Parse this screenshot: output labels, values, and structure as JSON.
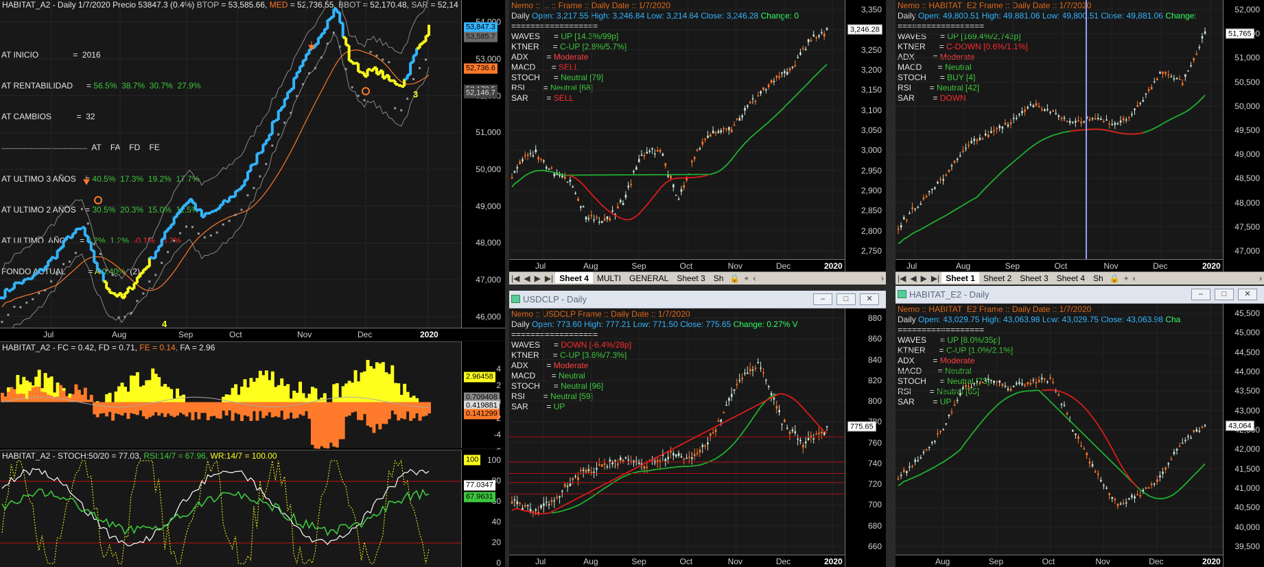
{
  "colors": {
    "bg": "#181818",
    "cyan": "#33b5ff",
    "yellow": "#ffff1e",
    "orange": "#ff7a2a",
    "green": "#3ec83e",
    "red": "#ff2a2a",
    "white": "#ffffff",
    "grey": "#999999",
    "pale": "#cde6d8"
  },
  "left": {
    "header": {
      "prefix": "HABITAT_A2 - Daily 1/7/2020 Precio 53847.3 (0.4%)",
      "btop_label": "BTOP",
      "btop_val": " = 53,585.66,",
      "med_label": "MED",
      "med_val": " = 52,736.55,",
      "bbot_label": "BBOT",
      "bbot_val": " = 52,170.48,",
      "sar_label": "SAR",
      "sar_val": " = 52,14"
    },
    "stats": {
      "inicio": "AT INICIO               =  2016",
      "rent_label": "AT RENTABILIDAD      = ",
      "rent_vals": [
        "56.5%",
        "38.7%",
        "30.7%",
        "27.9%"
      ],
      "cambios": "AT CAMBIOS           =  32",
      "divider": "-----------------------------------------------",
      "cols": [
        "AT",
        "FA",
        "FD",
        "FE"
      ],
      "u3_label": "AT ULTIMO 3 AÑOS    = ",
      "u3_vals": [
        "40.5%",
        "17.3%",
        "19.2%",
        "17.7%"
      ],
      "u2_label": "AT ULTIMO 2 AÑOS    = ",
      "u2_vals": [
        "30.5%",
        "20.3%",
        "15.0%",
        "11.5%"
      ],
      "u1_label": "AT ULTIMO  AÑO      = ",
      "u1_vals": [
        "0.2%",
        "1.2%",
        "-0.1%",
        "-0.2%"
      ],
      "fondo_label": "FONDO ACTUAL          = ",
      "fondo_a": "A",
      "fondo_pct": "0.40%",
      "fondo_n": "(2)"
    },
    "y_ticks": [
      "54,000",
      "53,000",
      "52,000",
      "51,000",
      "50,000",
      "49,000",
      "48,000",
      "47,000",
      "46,000"
    ],
    "tags": [
      {
        "t": "53,847.3",
        "bg": "#33b5ff",
        "c": "#000"
      },
      {
        "t": "53,585.7",
        "bg": "#6c6c6c",
        "c": "#111"
      },
      {
        "t": "52,736.6",
        "bg": "#ff7a2a",
        "c": "#000"
      },
      {
        "t": "52,170.5",
        "bg": "#444",
        "c": "#ddd"
      },
      {
        "t": "52,146.7",
        "bg": "#444",
        "c": "#ddd"
      }
    ],
    "x_ticks": [
      "Jul",
      "Aug",
      "Sep",
      "Oct",
      "Nov",
      "Dec",
      "2020"
    ],
    "markers": {
      "m4": "4",
      "m3": "3"
    },
    "panel2": {
      "title_prefix": "HABITAT_A2 - FC = 0.42, FD = 0.71,",
      "fe": " FE = 0.14,",
      "fa": " FA = 2.96",
      "y_ticks": [
        "4",
        "2",
        "0",
        "-2",
        "-4",
        "-6"
      ],
      "tags": [
        {
          "t": "2.96458",
          "bg": "#ffff1e",
          "c": "#000"
        },
        {
          "t": "0.709408",
          "bg": "#888",
          "c": "#000"
        },
        {
          "t": "0.419881",
          "bg": "#ddd",
          "c": "#000"
        },
        {
          "t": "0.141299",
          "bg": "#ff7a2a",
          "c": "#000"
        }
      ]
    },
    "panel3": {
      "title_prefix": "HABITAT_A2 - STOCH:50/20 = 77.03,",
      "rsi": " RSI:14/7 = 67.96,",
      "wr": " WR:14/7 = 100.00",
      "y_ticks": [
        "100",
        "80",
        "60",
        "40",
        "20",
        "0"
      ],
      "tags": [
        {
          "t": "100",
          "bg": "#ffff1e",
          "c": "#000"
        },
        {
          "t": "77.0347",
          "bg": "#fff",
          "c": "#000"
        },
        {
          "t": "67.9631",
          "bg": "#3ec83e",
          "c": "#000"
        }
      ]
    }
  },
  "tl": {
    "header_line": "Nemo :: ... ::     Frame :: Daily     Date :: 1/7/2020",
    "ohlc": {
      "daily": "Daily",
      "open": "Open:  3,217.55",
      "high": "High:  3,246.84",
      "low": "Low:  3,214.64",
      "close": "Close:  3,246.28",
      "change": "Change:  0"
    },
    "lines": [
      "==================",
      "WAVES      = ",
      "KTNER      = ",
      "ADX        = ",
      "MACD       = ",
      "STOCH      = ",
      "RSI        = ",
      "SAR        = "
    ],
    "vals": [
      {
        "t": "",
        "c": "#fff"
      },
      {
        "t": "UP [14.3%/99p]",
        "c": "#3ec83e"
      },
      {
        "t": "C-UP [2.8%/5.7%]",
        "c": "#3ec83e"
      },
      {
        "t": "Moderate",
        "c": "#ff4040"
      },
      {
        "t": "SELL",
        "c": "#ff2a2a"
      },
      {
        "t": "Neutral [79]",
        "c": "#3ec83e"
      },
      {
        "t": "Neutral [68]",
        "c": "#3ec83e"
      },
      {
        "t": "SELL",
        "c": "#ff2a2a"
      }
    ],
    "y_ticks": [
      "3,350",
      "3,300",
      "3,250",
      "3,200",
      "3,150",
      "3,100",
      "3,050",
      "3,000",
      "2,950",
      "2,900",
      "2,850",
      "2,800",
      "2,750"
    ],
    "tag": "3,246.28",
    "x_ticks": [
      "Jul",
      "Aug",
      "Sep",
      "Oct",
      "Nov",
      "Dec",
      "2020"
    ],
    "tabs": [
      "Sheet 4",
      "MULTI",
      "GENERAL",
      "Sheet 3",
      "Sh"
    ]
  },
  "tr": {
    "header_line": "Nemo :: HABITAT_E2     Frame :: Daily     Date :: 1/7/2020",
    "ohlc": {
      "daily": "Daily",
      "open": "Open:  49,800.51",
      "high": "High:  49,881.06",
      "low": "Low:  49,800.51",
      "close": "Close:  49,881.06",
      "change": "Change:"
    },
    "lines": [
      "==================",
      "WAVES      = ",
      "KTNER      = ",
      "ADX        = ",
      "MACD       = ",
      "STOCH      = ",
      "RSI        = ",
      "SAR        = "
    ],
    "vals": [
      {
        "t": "",
        "c": "#fff"
      },
      {
        "t": "UP [169.4%/2,743p]",
        "c": "#3ec83e"
      },
      {
        "t": "C-DOWN [0.6%/1.1%]",
        "c": "#ff2a2a"
      },
      {
        "t": "Moderate",
        "c": "#ff4040"
      },
      {
        "t": "Neutral",
        "c": "#3ec83e"
      },
      {
        "t": "BUY [4]",
        "c": "#3ec83e"
      },
      {
        "t": "Neutral [42]",
        "c": "#3ec83e"
      },
      {
        "t": "DOWN",
        "c": "#ff2a2a"
      }
    ],
    "y_ticks": [
      "52,000",
      "51,500",
      "51,000",
      "50,500",
      "50,000",
      "49,500",
      "49,000",
      "48,500",
      "48,000",
      "47,500",
      "47,000"
    ],
    "tag": "51,765",
    "x_ticks": [
      "Jul",
      "Aug",
      "Sep",
      "Oct",
      "Nov",
      "Dec",
      "2020"
    ],
    "tabs": [
      "Sheet 1",
      "Sheet 2",
      "Sheet 3",
      "Sheet 4",
      "Sh"
    ]
  },
  "bl": {
    "title": "USDCLP  -  Daily",
    "header_line": "Nemo :: USDCLP     Frame :: Daily     Date :: 1/7/2020",
    "ohlc": {
      "daily": "Daily",
      "open": "Open:  773.60",
      "high": "High:  777.21",
      "low": "Low:  771.50",
      "close": "Close:  775.65",
      "change": "Change:  0.27%  V"
    },
    "lines": [
      "==================",
      "WAVES      = ",
      "KTNER      = ",
      "ADX        = ",
      "MACD       = ",
      "STOCH      = ",
      "RSI        = ",
      "SAR        = "
    ],
    "vals": [
      {
        "t": "",
        "c": "#fff"
      },
      {
        "t": "DOWN [-6.4%/28p]",
        "c": "#ff2a2a"
      },
      {
        "t": "C-UP [3.6%/7.3%]",
        "c": "#3ec83e"
      },
      {
        "t": "Moderate",
        "c": "#ff4040"
      },
      {
        "t": "Neutral",
        "c": "#3ec83e"
      },
      {
        "t": "Neutral [96]",
        "c": "#3ec83e"
      },
      {
        "t": "Neutral [59]",
        "c": "#3ec83e"
      },
      {
        "t": "UP",
        "c": "#3ec83e"
      }
    ],
    "y_ticks": [
      "880",
      "860",
      "840",
      "820",
      "800",
      "780",
      "760",
      "740",
      "720",
      "700",
      "680",
      "660"
    ],
    "tag": "775.65",
    "x_ticks": [
      "Jul",
      "Aug",
      "Sep",
      "Oct",
      "Nov",
      "Dec",
      "2020"
    ]
  },
  "br": {
    "title": "HABITAT_E2  -  Daily",
    "header_line": "Nemo :: HABITAT_E2     Frame :: Daily     Date :: 1/7/2020",
    "ohlc": {
      "daily": "Daily",
      "open": "Open:  43,029.75",
      "high": "High:  43,063.98",
      "low": "Low:  43,029.75",
      "close": "Close:  43,063.98",
      "change": "Cha"
    },
    "lines": [
      "==================",
      "WAVES      = ",
      "KTNER      = ",
      "ADX        = ",
      "MACD       = ",
      "STOCH      = ",
      "RSI        = ",
      "SAR        = "
    ],
    "vals": [
      {
        "t": "",
        "c": "#fff"
      },
      {
        "t": "UP [8.0%/35p]",
        "c": "#3ec83e"
      },
      {
        "t": "C-UP [1.0%/2.1%]",
        "c": "#3ec83e"
      },
      {
        "t": "Moderate",
        "c": "#ff4040"
      },
      {
        "t": "Neutral",
        "c": "#3ec83e"
      },
      {
        "t": "Neutral [73]",
        "c": "#3ec83e"
      },
      {
        "t": "Neutral [65]",
        "c": "#3ec83e"
      },
      {
        "t": "UP",
        "c": "#3ec83e"
      }
    ],
    "y_ticks": [
      "45,500",
      "45,000",
      "44,500",
      "44,000",
      "43,500",
      "43,000",
      "42,500",
      "42,000",
      "41,500",
      "41,000",
      "40,500",
      "40,000",
      "39,500"
    ],
    "tag": "43,064",
    "x_ticks": [
      "Aug",
      "Sep",
      "Oct",
      "Nov",
      "Dec",
      "2020"
    ]
  }
}
